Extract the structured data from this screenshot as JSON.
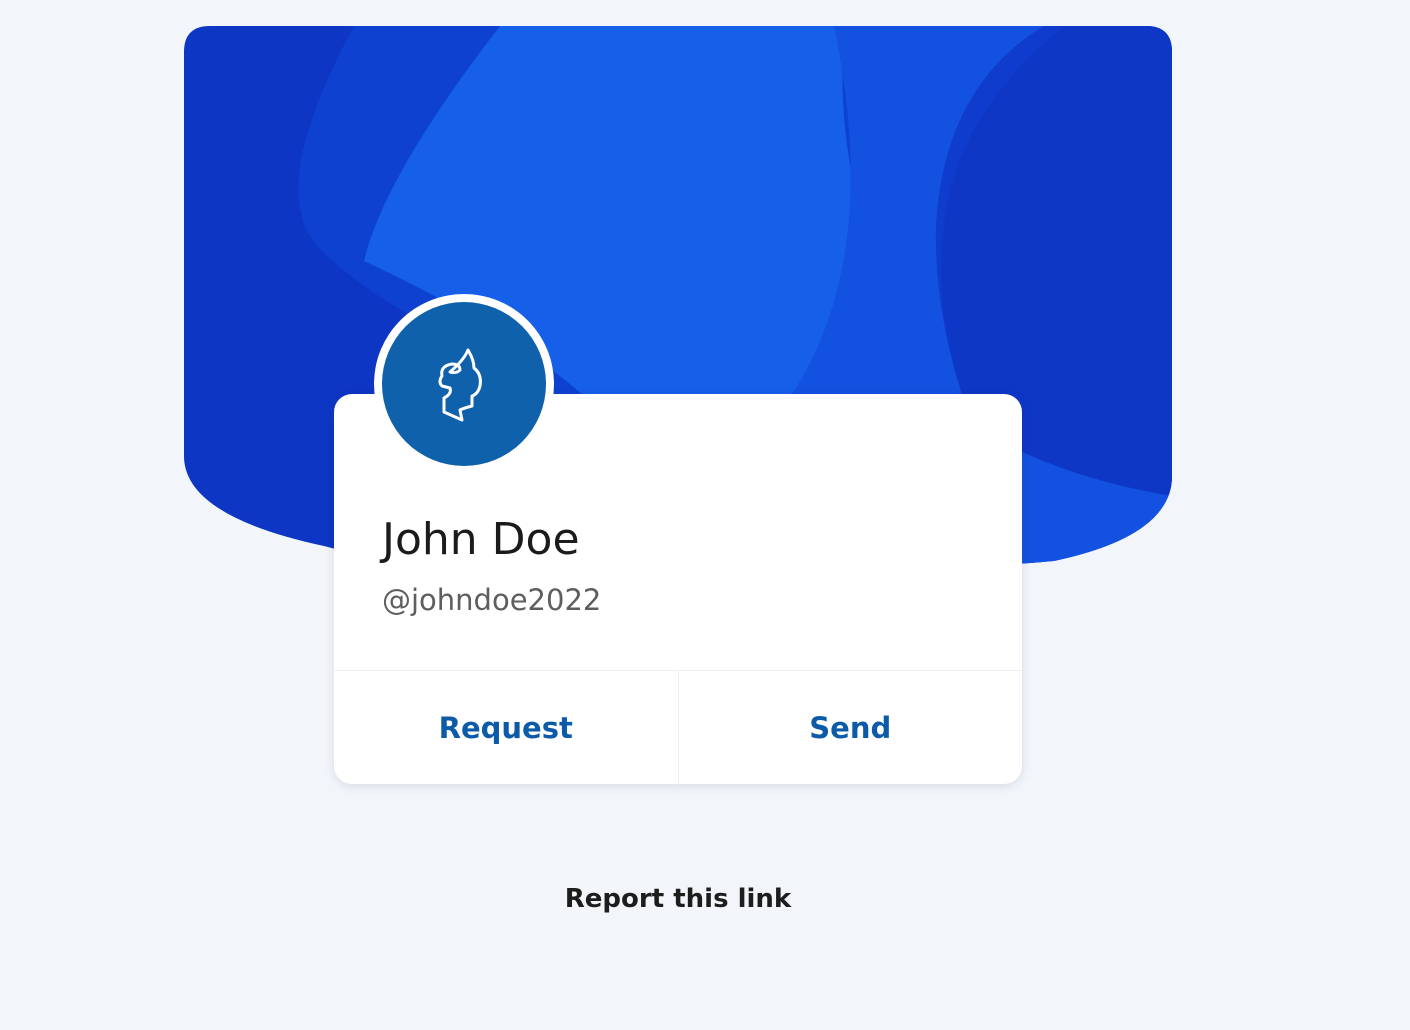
{
  "profile": {
    "name": "John Doe",
    "handle": "@johndoe2022",
    "avatar_icon": "profile-head-icon"
  },
  "actions": {
    "request_label": "Request",
    "send_label": "Send"
  },
  "footer": {
    "report_label": "Report this link"
  },
  "colors": {
    "page_background": "#f2f5fa",
    "hero_dark": "#0e36c4",
    "hero_mid": "#0f41d0",
    "hero_light": "#155fe9",
    "avatar_background": "#1061ac",
    "action_text": "#0d5ba8"
  }
}
